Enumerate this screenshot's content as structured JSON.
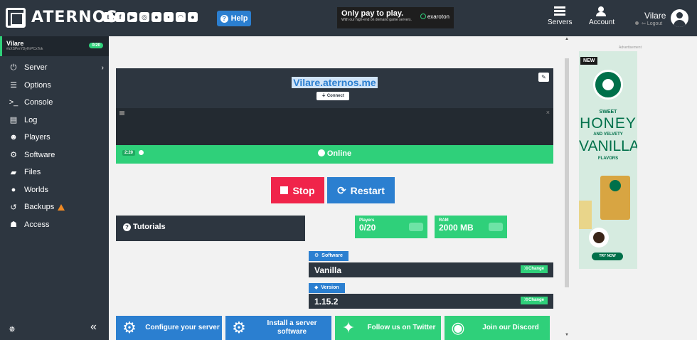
{
  "header": {
    "brand": "ATERNOS",
    "social_icons": [
      "twitter-icon",
      "facebook-icon",
      "youtube-icon",
      "instagram-icon",
      "reddit-icon",
      "chat-icon",
      "teamspeak-icon",
      "github-icon"
    ],
    "help_label": "Help",
    "ad": {
      "title": "Only pay to play.",
      "subtitle": "With our high-end on demand game servers.",
      "sponsor": "exaroton"
    },
    "nav": [
      {
        "label": "Servers",
        "icon": "servers-icon"
      },
      {
        "label": "Account",
        "icon": "account-icon"
      }
    ],
    "user": {
      "name": "Vilare",
      "logout_label": "Logout"
    }
  },
  "sidebar": {
    "server": {
      "name": "Vilare",
      "id": "#sXSPmYDyHrPCxTok",
      "badge": "0/20"
    },
    "items": [
      {
        "label": "Server",
        "icon": "power-icon"
      },
      {
        "label": "Options",
        "icon": "sliders-icon"
      },
      {
        "label": "Console",
        "icon": "terminal-icon"
      },
      {
        "label": "Log",
        "icon": "file-icon"
      },
      {
        "label": "Players",
        "icon": "users-icon"
      },
      {
        "label": "Software",
        "icon": "cogs-icon"
      },
      {
        "label": "Files",
        "icon": "folder-icon"
      },
      {
        "label": "Worlds",
        "icon": "globe-icon"
      },
      {
        "label": "Backups",
        "icon": "history-icon"
      },
      {
        "label": "Access",
        "icon": "user-lock-icon"
      }
    ]
  },
  "server_panel": {
    "address": "Vilare.aternos.me",
    "connect_label": "Connect",
    "time": "2:20",
    "status": "Online",
    "colors": {
      "online": "#2fd07a",
      "stop": "#f0244a",
      "restart": "#2b7fd0"
    }
  },
  "actions": {
    "stop": "Stop",
    "restart": "Restart"
  },
  "tutorials_label": "Tutorials",
  "stats": {
    "players": {
      "label": "Players",
      "value": "0/20"
    },
    "ram": {
      "label": "RAM",
      "value": "2000 MB"
    }
  },
  "software": {
    "label": "Software",
    "value": "Vanilla",
    "change": "Change"
  },
  "version": {
    "label": "Version",
    "value": "1.15.2",
    "change": "Change"
  },
  "cards": [
    {
      "label": "Configure your server"
    },
    {
      "label": "Install a server software"
    },
    {
      "label": "Follow us on Twitter"
    },
    {
      "label": "Join our Discord"
    }
  ],
  "side_ad": {
    "label": "Advertisement",
    "badge": "NEW",
    "line1": "SWEET",
    "line2": "HONEY",
    "line3": "AND VELVETY",
    "line4": "VANILLA",
    "line5": "FLAVORS",
    "cta": "TRY NOW"
  }
}
